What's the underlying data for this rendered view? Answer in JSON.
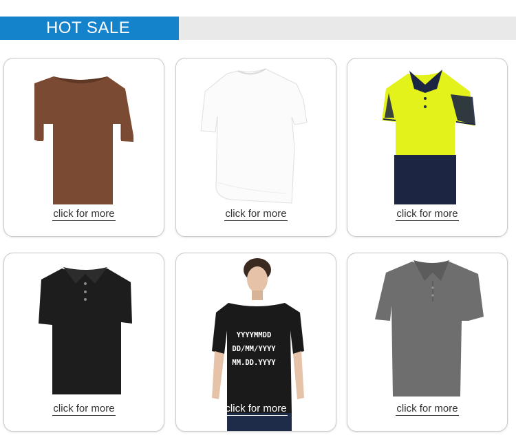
{
  "banner": {
    "title": "HOT SALE"
  },
  "products": [
    {
      "image": "brown-tshirt",
      "link_label": "click for more",
      "color": "#7b4a33"
    },
    {
      "image": "white-tshirt",
      "link_label": "click for more",
      "color": "#fafafa"
    },
    {
      "image": "hi-vis-polo",
      "link_label": "click for more",
      "color": "#e4f21c"
    },
    {
      "image": "black-polo",
      "link_label": "click for more",
      "color": "#1c1c1c"
    },
    {
      "image": "model-printed-tshirt",
      "link_label": "click for more",
      "color": "#1a1a1a",
      "print_lines": [
        "YYYYMMDD",
        "DD/MM/YYYY",
        "MM.DD.YYYY"
      ]
    },
    {
      "image": "grey-polo",
      "link_label": "click for more",
      "color": "#6e6e6e"
    }
  ],
  "colors": {
    "accent": "#1583cc",
    "banner_bg": "#e9e9ea",
    "card_border": "#c9c9c9"
  }
}
